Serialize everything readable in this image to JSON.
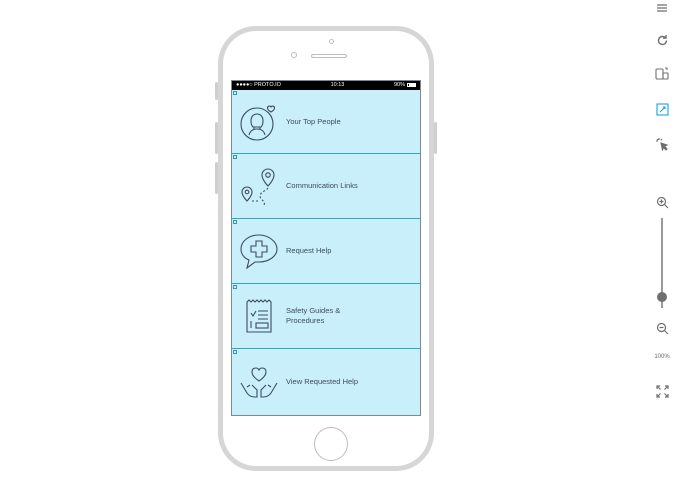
{
  "statusbar": {
    "carrier": "●●●●○ PROTO.IO",
    "time": "10:13",
    "battery": "90%"
  },
  "tiles": [
    {
      "label": "Your Top People",
      "icon": "person-heart-icon"
    },
    {
      "label": "Communication Links",
      "icon": "location-route-icon"
    },
    {
      "label": "Request Help",
      "icon": "medical-speech-icon"
    },
    {
      "label": "Safety Guides &\nProcedures",
      "icon": "checklist-clipboard-icon"
    },
    {
      "label": "View Requested Help",
      "icon": "hands-heart-icon"
    }
  ],
  "toolbar": {
    "zoom_level": "100%",
    "zoom_fraction": 0.88
  },
  "colors": {
    "screen_bg": "#c9effa",
    "tile_divider": "#2fa6c4",
    "icon_stroke": "#3d4a63",
    "active_tool": "#1aa3d9"
  }
}
